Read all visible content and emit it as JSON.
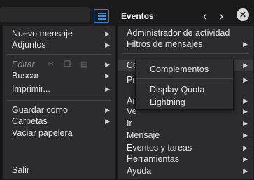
{
  "app": {
    "title": "Eventos",
    "close_glyph": "✕"
  },
  "main_menu": {
    "items": [
      {
        "label": "Nuevo mensaje",
        "arrow": "▶"
      },
      {
        "label": "Adjuntos",
        "arrow": "▶"
      },
      {
        "label": "Editar",
        "arrow": "▶",
        "disabled": true
      },
      {
        "label": "Buscar",
        "arrow": "▶"
      },
      {
        "label": "Imprimir...",
        "arrow": "▶"
      },
      {
        "label": "Guardar como",
        "arrow": "▶"
      },
      {
        "label": "Carpetas",
        "arrow": "▶"
      },
      {
        "label": "Vaciar papelera"
      },
      {
        "label": "Salir"
      }
    ],
    "edit_icons": [
      "scissors-icon",
      "copy-icon",
      "paste-icon"
    ]
  },
  "right_menu": {
    "items": [
      {
        "label": "Administrador de actividad"
      },
      {
        "label": "Filtros de mensajes",
        "arrow": "▶"
      },
      {
        "label": "Co",
        "arrow": "▶"
      },
      {
        "label": "Pr",
        "arrow": "▶"
      },
      {
        "label": "Ar",
        "arrow": "▶"
      },
      {
        "label": "Ve",
        "arrow": "▶"
      },
      {
        "label": "Ir",
        "arrow": "▶"
      },
      {
        "label": "Mensaje",
        "arrow": "▶"
      },
      {
        "label": "Eventos y tareas",
        "arrow": "▶"
      },
      {
        "label": "Herramientas",
        "arrow": "▶"
      },
      {
        "label": "Ayuda",
        "arrow": "▶"
      }
    ]
  },
  "sub_menu": {
    "items": [
      {
        "label": "Complementos"
      },
      {
        "label": "Display Quota"
      },
      {
        "label": "Lightning"
      }
    ]
  }
}
